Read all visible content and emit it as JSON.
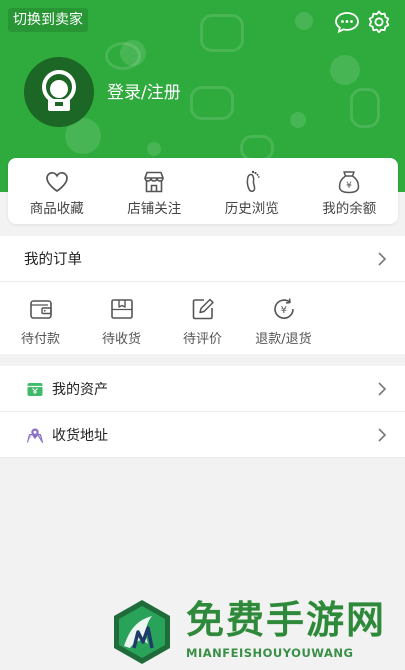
{
  "header": {
    "switch_seller": "切换到卖家",
    "login_register": "登录/注册",
    "icons": [
      "chat-icon",
      "settings-icon"
    ],
    "bg_color": "#2eab3c"
  },
  "quick_links": [
    {
      "label": "商品收藏",
      "icon": "heart-icon"
    },
    {
      "label": "店铺关注",
      "icon": "store-icon"
    },
    {
      "label": "历史浏览",
      "icon": "footprint-icon"
    },
    {
      "label": "我的余额",
      "icon": "money-bag-icon"
    }
  ],
  "orders": {
    "title": "我的订单",
    "items": [
      {
        "label": "待付款",
        "icon": "wallet-icon"
      },
      {
        "label": "待收货",
        "icon": "package-icon"
      },
      {
        "label": "待评价",
        "icon": "edit-icon"
      },
      {
        "label": "退款/退货",
        "icon": "refund-icon"
      }
    ]
  },
  "list": [
    {
      "label": "我的资产",
      "icon": "assets-icon",
      "color": "#3dbb6a"
    },
    {
      "label": "收货地址",
      "icon": "address-icon",
      "color": "#8b6fc4"
    }
  ],
  "watermark": {
    "title": "免费手游网",
    "subtitle": "MIANFEISHOUYOUWANG"
  }
}
